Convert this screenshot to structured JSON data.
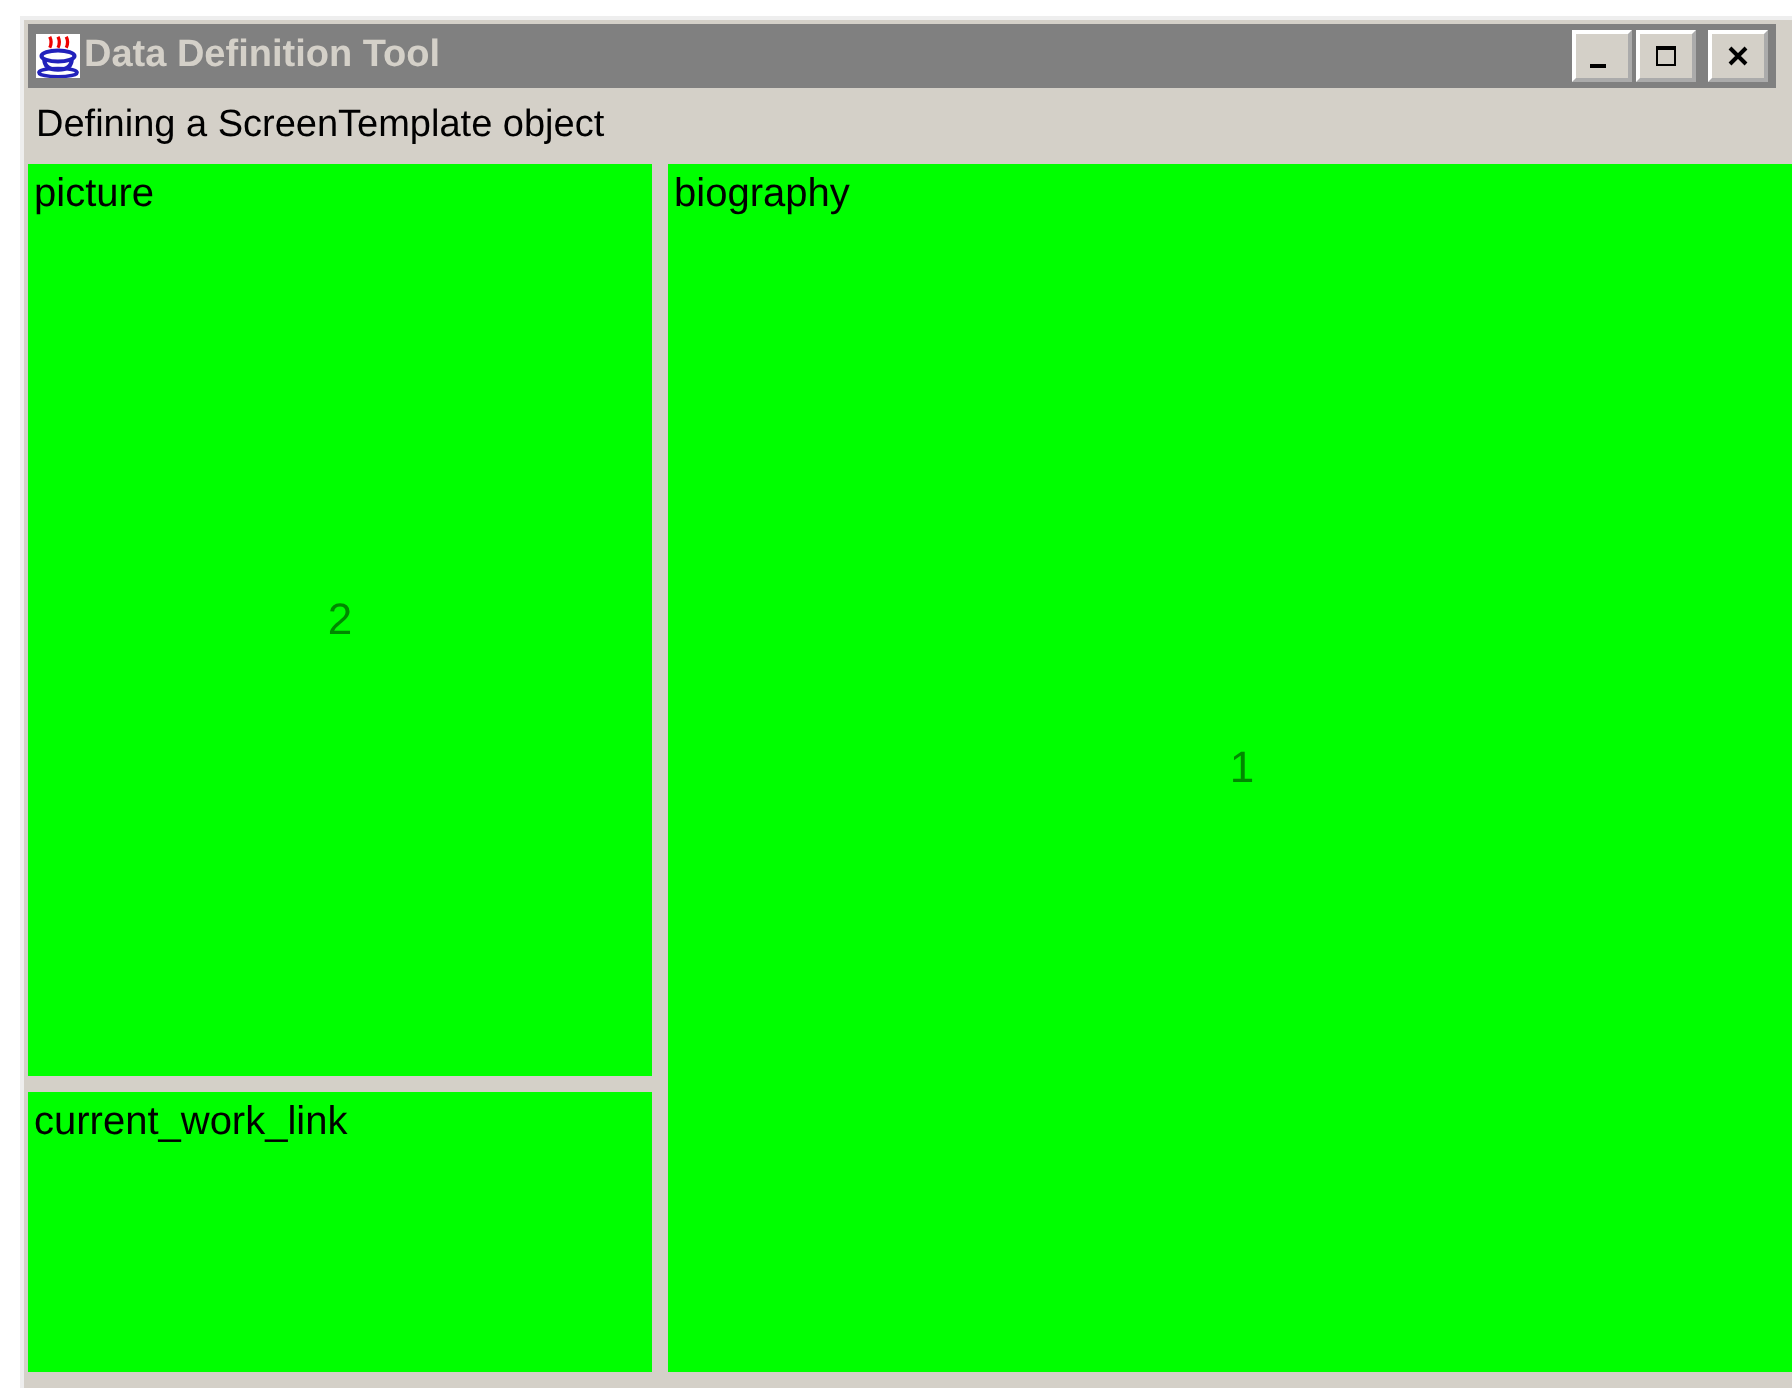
{
  "window": {
    "title": "Data Definition Tool",
    "active": false
  },
  "header": "Defining a ScreenTemplate object",
  "panels": [
    {
      "label": "picture",
      "number": "2"
    },
    {
      "label": "current_work_link"
    },
    {
      "label": "biography",
      "number": "1"
    }
  ]
}
